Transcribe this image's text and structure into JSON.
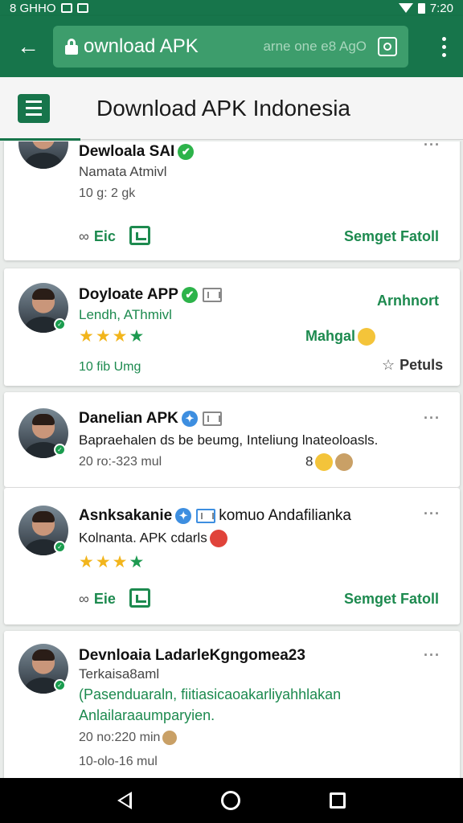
{
  "status_bar": {
    "left_text": "8 GHHO",
    "time": "7:20"
  },
  "browser": {
    "url_text": "ownload APK",
    "url_hint": "arne one e8 AgO"
  },
  "header": {
    "title": "Download APK Indonesia"
  },
  "posts": [
    {
      "name": "Dewloala SAI",
      "subtitle": "Namata Atmivl",
      "time": "10 g: 2 gk",
      "action_left": "Eic",
      "action_right": "Semget Fatoll"
    },
    {
      "name": "Doyloate APP",
      "subtitle": "Lendh, AThmivl",
      "right_label": "Arnhnort",
      "rating_label": "Mahgal",
      "time": "10 fib Umg",
      "action_right": "Petuls",
      "stars_yellow": 3,
      "stars_green": 1
    },
    {
      "name": "Danelian APK",
      "subtitle": "Bapraehalen ds be beumg, Inteliung lnateoloasls.",
      "time": "20 ro:-323 mul",
      "trail_icon": "8"
    },
    {
      "name": "Asnksakanie",
      "name_suffix": "komuo Andafilianka",
      "subtitle": "Kolnanta. APK cdarls",
      "stars_yellow": 3,
      "stars_green": 1,
      "action_left": "Eie",
      "action_right": "Semget Fatoll"
    },
    {
      "name": "Devnloaia LadarleKgngomea23",
      "subtitle": "Terkaisa8aml",
      "body_green": "(Pasenduaraln, fiitiasicaoakarliyahhlakan Anlailaraaumparyien.",
      "time": "20 no:220 min",
      "time2": "10-olo-16 mul"
    }
  ],
  "colors": {
    "brand_green": "#17754b",
    "link_green": "#1d8a4f",
    "star_yellow": "#f2b51c"
  }
}
